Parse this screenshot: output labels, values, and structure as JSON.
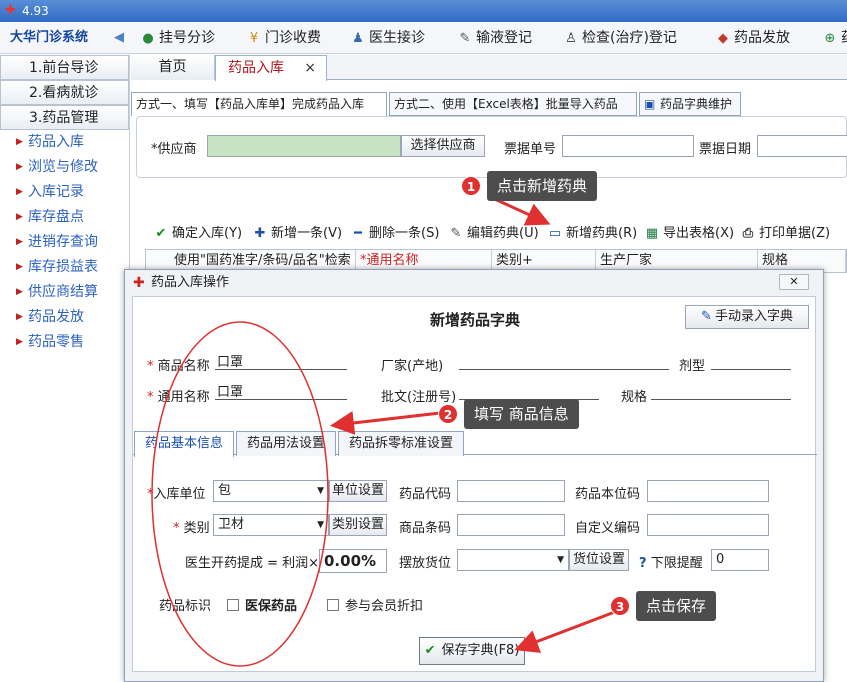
{
  "window": {
    "title": "4.93"
  },
  "toolbar": {
    "brand": "大华门诊系统",
    "items": [
      {
        "label": "挂号分诊",
        "icon": "people-icon"
      },
      {
        "label": "门诊收费",
        "icon": "yen-coin-icon"
      },
      {
        "label": "医生接诊",
        "icon": "doctor-icon"
      },
      {
        "label": "输液登记",
        "icon": "syringe-icon"
      },
      {
        "label": "检查(治疗)登记",
        "icon": "walking-person-icon"
      },
      {
        "label": "药品发放",
        "icon": "pill-icon"
      },
      {
        "label": "药",
        "icon": "plus-circle-icon"
      }
    ]
  },
  "sidebar": {
    "sections": [
      {
        "label": "1.前台导诊"
      },
      {
        "label": "2.看病就诊"
      },
      {
        "label": "3.药品管理"
      }
    ],
    "items": [
      "药品入库",
      "浏览与修改",
      "入库记录",
      "库存盘点",
      "进销存查询",
      "库存损益表",
      "供应商结算",
      "药品发放",
      "药品零售"
    ]
  },
  "tabs": {
    "home": "首页",
    "active": "药品入库",
    "close": "×"
  },
  "subtabs": [
    "方式一、填写【药品入库单】完成药品入库",
    "方式二、使用【Excel表格】批量导入药品",
    "药品字典维护"
  ],
  "form": {
    "supplier_label": "*供应商",
    "supplier_value": "",
    "choose_supplier": "选择供应商",
    "bill_no_label": "票据单号",
    "bill_date_label": "票据日期"
  },
  "actions": [
    {
      "label": "确定入库(Y)",
      "icon": "check-icon"
    },
    {
      "label": "新增一条(V)",
      "icon": "plus-icon"
    },
    {
      "label": "删除一条(S)",
      "icon": "minus-icon"
    },
    {
      "label": "编辑药典(U)",
      "icon": "edit-pen-icon"
    },
    {
      "label": "新增药典(R)",
      "icon": "new-doc-icon"
    },
    {
      "label": "导出表格(X)",
      "icon": "excel-icon"
    },
    {
      "label": "打印单据(Z)",
      "icon": "printer-icon"
    }
  ],
  "grid": {
    "columns": [
      "使用\"国药准字/条码/品名\"检索",
      "*通用名称",
      "类别+",
      "生产厂家",
      "规格"
    ]
  },
  "dialog": {
    "title": "药品入库操作",
    "close": "✕",
    "heading": "新增药品字典",
    "manual_button": "手动录入字典",
    "fields": {
      "product_name_label": "商品名称",
      "product_name_value": "口罩",
      "generic_name_label": "通用名称",
      "generic_name_value": "口罩",
      "manufacturer_label": "厂家(产地)",
      "dosage_form_label": "剂型",
      "approval_label": "批文(注册号)",
      "spec_label": "规格"
    },
    "tabs": [
      "药品基本信息",
      "药品用法设置",
      "药品拆零标准设置"
    ],
    "basic": {
      "unit_label": "入库单位",
      "unit_value": "包",
      "unit_button": "单位设置",
      "category_label": "类别",
      "category_value": "卫材",
      "category_button": "类别设置",
      "commission_label": "医生开药提成 = 利润×",
      "commission_value": "0.00%",
      "drug_code_label": "药品代码",
      "barcode_label": "商品条码",
      "location_label": "摆放货位",
      "location_button": "货位设置",
      "local_code_label": "药品本位码",
      "custom_code_label": "自定义编码",
      "min_alert_label": "下限提醒",
      "min_alert_value": "0",
      "mark_label": "药品标识",
      "insurance_label": "医保药品",
      "member_discount_label": "参与会员折扣"
    },
    "save_button": "保存字典(F8)"
  },
  "annotations": [
    {
      "num": "1",
      "text": "点击新增药典"
    },
    {
      "num": "2",
      "text": "填写 商品信息"
    },
    {
      "num": "3",
      "text": "点击保存"
    }
  ]
}
